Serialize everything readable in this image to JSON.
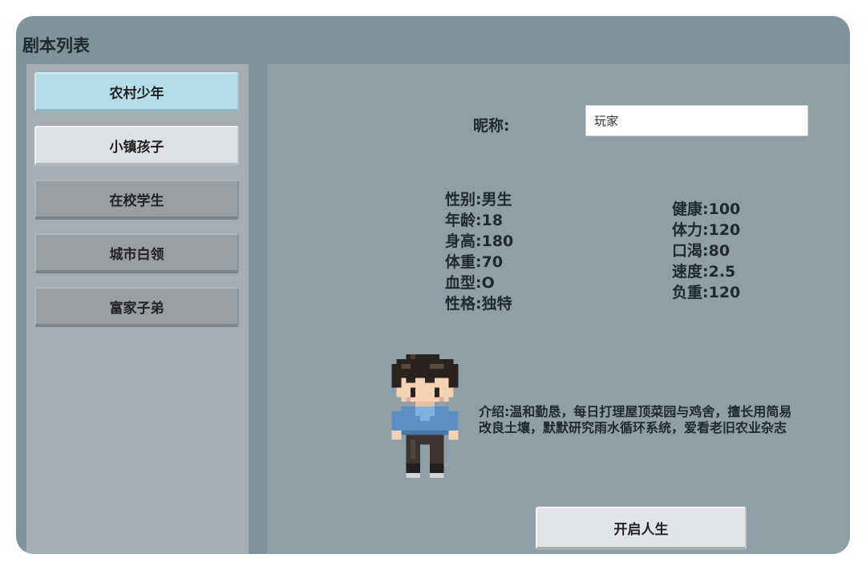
{
  "app": {
    "title": "剧本列表"
  },
  "scripts": {
    "items": [
      {
        "label": "农村少年",
        "state": "selected"
      },
      {
        "label": "小镇孩子",
        "state": "hovered"
      },
      {
        "label": "在校学生",
        "state": "normal"
      },
      {
        "label": "城市白领",
        "state": "normal"
      },
      {
        "label": "富家子弟",
        "state": "normal"
      }
    ]
  },
  "profile": {
    "nickname_label": "昵称:",
    "nickname_value": "玩家",
    "basic": [
      "性别:男生",
      "年龄:18",
      "身高:180",
      "体重:70",
      "血型:O",
      "性格:独特"
    ],
    "attributes": [
      "健康:100",
      "体力:120",
      "口渴:80",
      "速度:2.5",
      "负重:120"
    ],
    "intro_lines": [
      "介绍:温和勤恳，每日打理屋顶菜园与鸡舍，擅长用简易",
      "改良土壤，默默研究雨水循环系统，爱看老旧农业杂志"
    ]
  },
  "actions": {
    "start_label": "开启人生"
  },
  "colors": {
    "window_bg": "#7f939c",
    "sidebar_bg": "#a5adb3",
    "main_bg": "#8e9fa8",
    "selected_button": "#b4dde8",
    "hovered_button": "#dde1e4",
    "normal_button": "#999ea2"
  },
  "icons": {
    "avatar": "pixel-boy-character"
  }
}
